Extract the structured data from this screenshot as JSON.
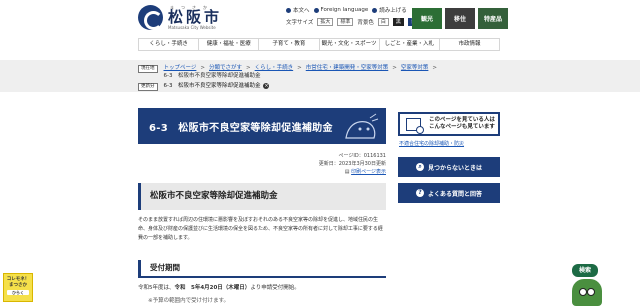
{
  "header": {
    "logo_ruby": "まつさか",
    "logo_name": "松阪市",
    "logo_en": "Matsusaka City Website",
    "util": {
      "text_version": "本文へ",
      "foreign_language": "Foreign language",
      "read_aloud": "読み上げる",
      "font_size_label": "文字サイズ",
      "enlarge": "拡大",
      "standard": "標準",
      "color_label": "背景色",
      "color_white": "白",
      "color_black": "黒",
      "color_blue": "青"
    },
    "photo_nav": [
      "観光",
      "移住",
      "特産品"
    ]
  },
  "gnav": [
    "くらし・手続き",
    "健康・福祉・医療",
    "子育て・教育",
    "観光・文化・スポーツ",
    "しごと・産業・入札",
    "市政情報"
  ],
  "breadcrumb": {
    "current_tag": "現在地",
    "items": [
      "トップページ",
      "分類でさがす",
      "くらし・手続き",
      "市営住宅・建築開発・空家等対策",
      "空家等対策"
    ],
    "current_page": "6-3　松阪市不良空家等除却促進補助金",
    "history_tag": "更新分",
    "history_page": "6-3　松阪市不良空家等除却促進補助金"
  },
  "page": {
    "title": "6-3　松阪市不良空家等除却促進補助金",
    "page_id": "ページID：0116131",
    "updated": "更新日：2023年3月30日更新",
    "print": "印刷ページ表示",
    "section_title": "松阪市不良空家等除却促進補助金",
    "body": "そのまま放置すれば周辺の住環境に悪影響を及ぼすおそれのある不良空家等の除却を促進し、地域住民の生命、身体及び財産の保護並びに生活環境の保全を図るため、不良空家等の所有者に対して除却工事に要する経費の一部を補助します。",
    "period_heading": "受付期間",
    "period_prefix": "令和5年度は、",
    "period_date": "令和　5年4月20日（木曜日）",
    "period_suffix": "より申請受付開始。",
    "period_note": "※予算の範囲内で受け付けます。"
  },
  "sidebar": {
    "find_text_1": "このページを見ている人は",
    "find_text_2": "こんなページも見ています",
    "related_link": "不適合住宅の除却補助・防災",
    "btn_trouble": "見つからないときは",
    "btn_faq": "よくある質問と回答"
  },
  "widgets": {
    "left_badge_1": "コレモネ！",
    "left_badge_2": "まつさか",
    "left_badge_3": "ひらく",
    "search_label": "検索"
  }
}
